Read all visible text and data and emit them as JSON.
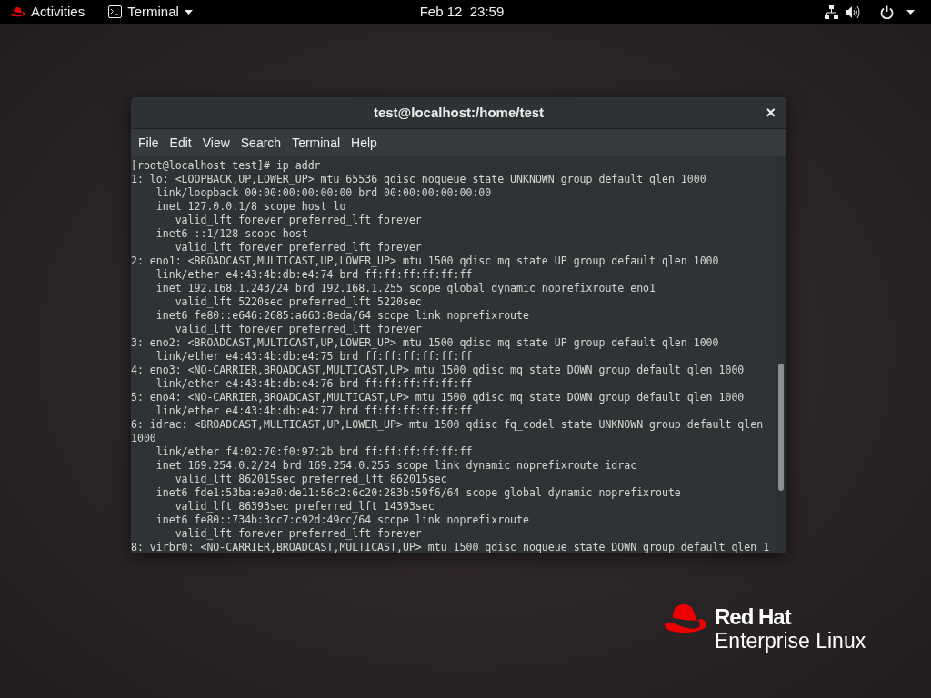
{
  "top_bar": {
    "activities": "Activities",
    "app_menu": "Terminal",
    "clock": "Feb 12  23:59"
  },
  "window": {
    "title": "test@localhost:/home/test",
    "close": "×",
    "menu": [
      "File",
      "Edit",
      "View",
      "Search",
      "Terminal",
      "Help"
    ],
    "lines": [
      "[root@localhost test]# ip addr",
      "1: lo: <LOOPBACK,UP,LOWER_UP> mtu 65536 qdisc noqueue state UNKNOWN group default qlen 1000",
      "    link/loopback 00:00:00:00:00:00 brd 00:00:00:00:00:00",
      "    inet 127.0.0.1/8 scope host lo",
      "       valid_lft forever preferred_lft forever",
      "    inet6 ::1/128 scope host",
      "       valid_lft forever preferred_lft forever",
      "2: eno1: <BROADCAST,MULTICAST,UP,LOWER_UP> mtu 1500 qdisc mq state UP group default qlen 1000",
      "    link/ether e4:43:4b:db:e4:74 brd ff:ff:ff:ff:ff:ff",
      "    inet 192.168.1.243/24 brd 192.168.1.255 scope global dynamic noprefixroute eno1",
      "       valid_lft 5220sec preferred_lft 5220sec",
      "    inet6 fe80::e646:2685:a663:8eda/64 scope link noprefixroute",
      "       valid_lft forever preferred_lft forever",
      "3: eno2: <BROADCAST,MULTICAST,UP,LOWER_UP> mtu 1500 qdisc mq state UP group default qlen 1000",
      "    link/ether e4:43:4b:db:e4:75 brd ff:ff:ff:ff:ff:ff",
      "4: eno3: <NO-CARRIER,BROADCAST,MULTICAST,UP> mtu 1500 qdisc mq state DOWN group default qlen 1000",
      "    link/ether e4:43:4b:db:e4:76 brd ff:ff:ff:ff:ff:ff",
      "5: eno4: <NO-CARRIER,BROADCAST,MULTICAST,UP> mtu 1500 qdisc mq state DOWN group default qlen 1000",
      "    link/ether e4:43:4b:db:e4:77 brd ff:ff:ff:ff:ff:ff",
      "6: idrac: <BROADCAST,MULTICAST,UP,LOWER_UP> mtu 1500 qdisc fq_codel state UNKNOWN group default qlen",
      "1000",
      "    link/ether f4:02:70:f0:97:2b brd ff:ff:ff:ff:ff:ff",
      "    inet 169.254.0.2/24 brd 169.254.0.255 scope link dynamic noprefixroute idrac",
      "       valid_lft 862015sec preferred_lft 862015sec",
      "    inet6 fde1:53ba:e9a0:de11:56c2:6c20:283b:59f6/64 scope global dynamic noprefixroute",
      "       valid_lft 86393sec preferred_lft 14393sec",
      "    inet6 fe80::734b:3cc7:c92d:49cc/64 scope link noprefixroute",
      "       valid_lft forever preferred_lft forever",
      "8: virbr0: <NO-CARRIER,BROADCAST,MULTICAST,UP> mtu 1500 qdisc noqueue state DOWN group default qlen 1"
    ]
  },
  "logo": {
    "brand": "Red Hat",
    "product": "Enterprise Linux"
  }
}
